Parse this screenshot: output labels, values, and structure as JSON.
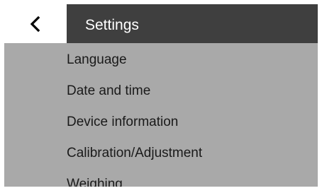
{
  "header": {
    "back_icon": "chevron-left-icon",
    "title": "Settings"
  },
  "menu": {
    "items": [
      {
        "label": "Language"
      },
      {
        "label": "Date and time"
      },
      {
        "label": "Device information"
      },
      {
        "label": "Calibration/Adjustment"
      },
      {
        "label": "Weighing"
      }
    ]
  },
  "colors": {
    "header_bg": "#3f3f3f",
    "back_bg": "#ffffff",
    "list_bg": "#a9a9a9",
    "title_text": "#ffffff",
    "item_text": "#1a1a1a"
  }
}
